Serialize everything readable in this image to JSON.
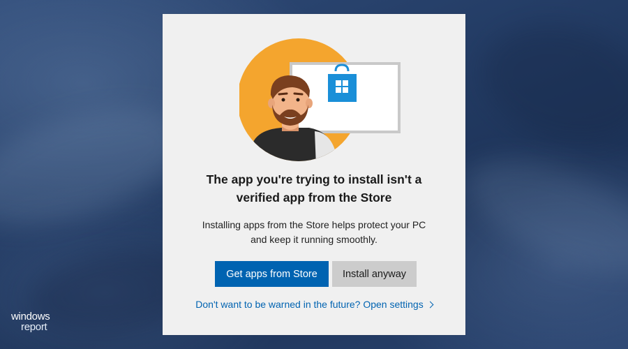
{
  "dialog": {
    "title_lines": [
      "The app you're trying to install isn't a",
      "verified app from the Store"
    ],
    "description_lines": [
      "Installing apps from the Store helps protect your PC",
      "and keep it running smoothly."
    ],
    "primary_button": "Get apps from Store",
    "secondary_button": "Install anyway",
    "settings_link": "Don't want to be warned in the future? Open settings",
    "settings_link_icon": "chevron-right-icon",
    "illustration_icon": "store-bag-icon"
  },
  "watermark": {
    "line1": "windows",
    "line2": "report"
  },
  "colors": {
    "accent": "#0063b1",
    "dialog_background": "#f0f0f0",
    "secondary_button": "#cccccc",
    "illustration_circle": "#f4a52e",
    "store_blue": "#1a8fd8"
  }
}
